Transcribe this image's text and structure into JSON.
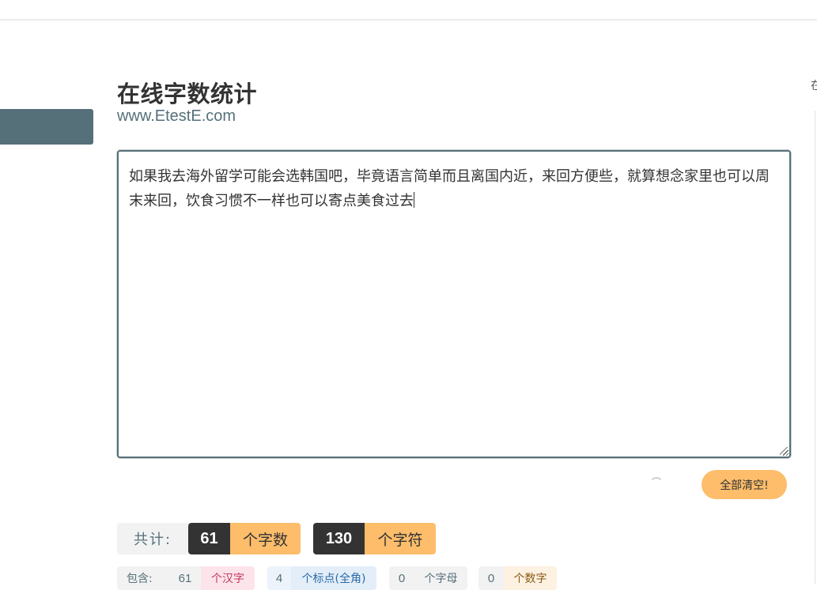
{
  "header": {
    "title": "在线字数统计",
    "subtitle": "www.EtestE.com",
    "right_edge_char": "在"
  },
  "editor": {
    "text": "如果我去海外留学可能会选韩国吧，毕竟语言简单而且离国内近，来回方便些，就算想念家里也可以周末来回，饮食习惯不一样也可以寄点美食过去"
  },
  "actions": {
    "clear_label": "全部清空!"
  },
  "stats": {
    "total_label": "共计:",
    "chars": {
      "value": "61",
      "unit": "个字数"
    },
    "symbols": {
      "value": "130",
      "unit": "个字符"
    }
  },
  "details": {
    "label": "包含:",
    "hanzi": {
      "value": "61",
      "unit": "个汉字"
    },
    "punct": {
      "value": "4",
      "unit": "个标点(全角)"
    },
    "letters": {
      "value": "0",
      "unit": "个字母"
    },
    "digits": {
      "value": "0",
      "unit": "个数字"
    }
  }
}
